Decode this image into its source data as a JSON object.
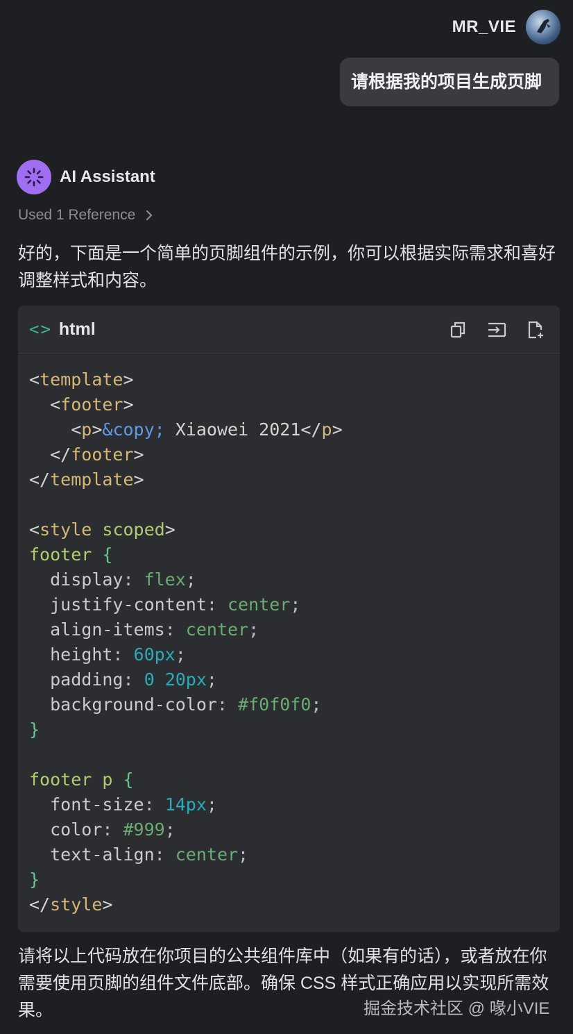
{
  "user": {
    "name": "MR_VIE",
    "message": "请根据我的项目生成页脚"
  },
  "assistant": {
    "name": "AI Assistant",
    "reference": "Used 1 Reference",
    "intro": "好的，下面是一个简单的页脚组件的示例，你可以根据实际需求和喜好调整样式和内容。",
    "outro": "请将以上代码放在你项目的公共组件库中（如果有的话），或者放在你需要使用页脚的组件文件底部。确保 CSS 样式正确应用以实现所需效果。"
  },
  "code_block": {
    "language": "html",
    "icon": "<>",
    "actions": [
      "copy-icon",
      "insert-icon",
      "new-file-icon"
    ],
    "lines": [
      [
        [
          "bracket",
          "<"
        ],
        [
          "tag",
          "template"
        ],
        [
          "bracket",
          ">"
        ]
      ],
      [
        [
          "text",
          "  "
        ],
        [
          "bracket",
          "<"
        ],
        [
          "tag",
          "footer"
        ],
        [
          "bracket",
          ">"
        ]
      ],
      [
        [
          "text",
          "    "
        ],
        [
          "bracket",
          "<"
        ],
        [
          "tag",
          "p"
        ],
        [
          "bracket",
          ">"
        ],
        [
          "ent",
          "&copy;"
        ],
        [
          "text",
          " Xiaowei 2021"
        ],
        [
          "bracket",
          "</"
        ],
        [
          "tag",
          "p"
        ],
        [
          "bracket",
          ">"
        ]
      ],
      [
        [
          "text",
          "  "
        ],
        [
          "bracket",
          "</"
        ],
        [
          "tag",
          "footer"
        ],
        [
          "bracket",
          ">"
        ]
      ],
      [
        [
          "bracket",
          "</"
        ],
        [
          "tag",
          "template"
        ],
        [
          "bracket",
          ">"
        ]
      ],
      [],
      [
        [
          "bracket",
          "<"
        ],
        [
          "tag",
          "style"
        ],
        [
          "text",
          " "
        ],
        [
          "sel",
          "scoped"
        ],
        [
          "bracket",
          ">"
        ]
      ],
      [
        [
          "sel",
          "footer"
        ],
        [
          "text",
          " "
        ],
        [
          "brace",
          "{"
        ]
      ],
      [
        [
          "text",
          "  "
        ],
        [
          "prop",
          "display"
        ],
        [
          "punct",
          ": "
        ],
        [
          "val",
          "flex"
        ],
        [
          "punct",
          ";"
        ]
      ],
      [
        [
          "text",
          "  "
        ],
        [
          "prop",
          "justify-content"
        ],
        [
          "punct",
          ": "
        ],
        [
          "val",
          "center"
        ],
        [
          "punct",
          ";"
        ]
      ],
      [
        [
          "text",
          "  "
        ],
        [
          "prop",
          "align-items"
        ],
        [
          "punct",
          ": "
        ],
        [
          "val",
          "center"
        ],
        [
          "punct",
          ";"
        ]
      ],
      [
        [
          "text",
          "  "
        ],
        [
          "prop",
          "height"
        ],
        [
          "punct",
          ": "
        ],
        [
          "num",
          "60px"
        ],
        [
          "punct",
          ";"
        ]
      ],
      [
        [
          "text",
          "  "
        ],
        [
          "prop",
          "padding"
        ],
        [
          "punct",
          ": "
        ],
        [
          "num",
          "0"
        ],
        [
          "text",
          " "
        ],
        [
          "num",
          "20px"
        ],
        [
          "punct",
          ";"
        ]
      ],
      [
        [
          "text",
          "  "
        ],
        [
          "prop",
          "background-color"
        ],
        [
          "punct",
          ": "
        ],
        [
          "val",
          "#f0f0f0"
        ],
        [
          "punct",
          ";"
        ]
      ],
      [
        [
          "brace",
          "}"
        ]
      ],
      [],
      [
        [
          "sel",
          "footer p"
        ],
        [
          "text",
          " "
        ],
        [
          "brace",
          "{"
        ]
      ],
      [
        [
          "text",
          "  "
        ],
        [
          "prop",
          "font-size"
        ],
        [
          "punct",
          ": "
        ],
        [
          "num",
          "14px"
        ],
        [
          "punct",
          ";"
        ]
      ],
      [
        [
          "text",
          "  "
        ],
        [
          "prop",
          "color"
        ],
        [
          "punct",
          ": "
        ],
        [
          "val",
          "#999"
        ],
        [
          "punct",
          ";"
        ]
      ],
      [
        [
          "text",
          "  "
        ],
        [
          "prop",
          "text-align"
        ],
        [
          "punct",
          ": "
        ],
        [
          "val",
          "center"
        ],
        [
          "punct",
          ";"
        ]
      ],
      [
        [
          "brace",
          "}"
        ]
      ],
      [
        [
          "bracket",
          "</"
        ],
        [
          "tag",
          "style"
        ],
        [
          "bracket",
          ">"
        ]
      ]
    ]
  },
  "watermark": "掘金技术社区 @ 喙小VIE"
}
